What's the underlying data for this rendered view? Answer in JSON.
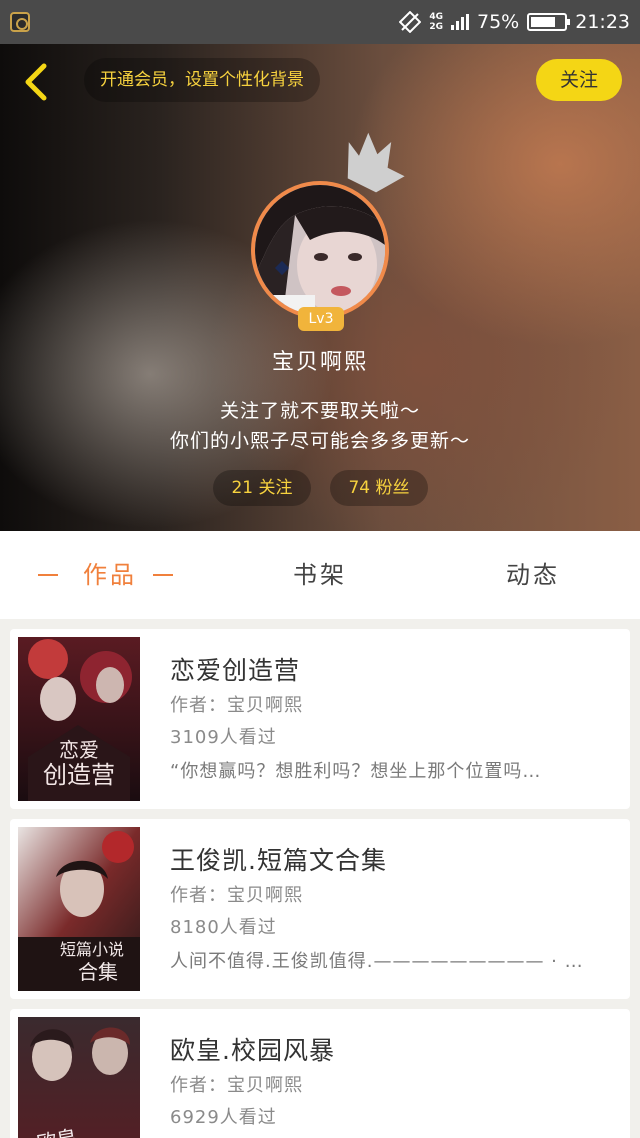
{
  "status_bar": {
    "network": [
      "4G",
      "2G"
    ],
    "battery_text": "75%",
    "battery_level": 0.75,
    "time": "21:23"
  },
  "header": {
    "vip_prompt": "开通会员，设置个性化背景",
    "follow_label": "关注",
    "level": "Lv3",
    "username": "宝贝啊熙",
    "bio_line1": "关注了就不要取关啦～",
    "bio_line2": "你们的小熙子尽可能会多多更新～",
    "following": "21 关注",
    "fans": "74 粉丝"
  },
  "tabs": {
    "works": "作品",
    "bookshelf": "书架",
    "activity": "动态",
    "active": "works"
  },
  "books": [
    {
      "title": "恋爱创造营",
      "author": "作者：宝贝啊熙",
      "views": "3109人看过",
      "excerpt": "“你想赢吗？想胜利吗？想坐上那个位置吗…",
      "cover_text": "恋爱创造营"
    },
    {
      "title": "王俊凯.短篇文合集",
      "author": "作者：宝贝啊熙",
      "views": "8180人看过",
      "excerpt": "人间不值得.王俊凯值得.————————— · …",
      "cover_text": "短篇小说合集"
    },
    {
      "title": "欧皇.校园风暴",
      "author": "作者：宝贝啊熙",
      "views": "6929人看过",
      "excerpt": "",
      "cover_text": "欧皇校园风暴"
    }
  ],
  "colors": {
    "accent": "#f0803c",
    "yellow": "#f4d615",
    "gold_text": "#f7d23e"
  }
}
